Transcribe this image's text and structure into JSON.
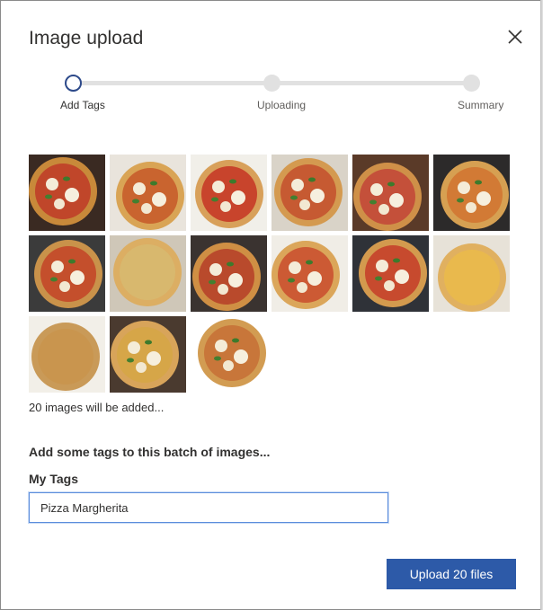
{
  "dialog": {
    "title": "Image upload"
  },
  "stepper": {
    "steps": [
      {
        "label": "Add Tags",
        "state": "active"
      },
      {
        "label": "Uploading",
        "state": "inactive"
      },
      {
        "label": "Summary",
        "state": "inactive"
      }
    ]
  },
  "thumbnails": [
    {
      "icon": "pizza-photo"
    },
    {
      "icon": "pizza-photo"
    },
    {
      "icon": "pizza-photo"
    },
    {
      "icon": "pizza-photo"
    },
    {
      "icon": "pizza-photo"
    },
    {
      "icon": "pizza-photo"
    },
    {
      "icon": "pizza-photo"
    },
    {
      "icon": "pizza-photo"
    },
    {
      "icon": "pizza-photo"
    },
    {
      "icon": "pizza-photo"
    },
    {
      "icon": "pizza-photo"
    },
    {
      "icon": "pizza-photo"
    },
    {
      "icon": "pizza-photo"
    },
    {
      "icon": "pizza-photo"
    },
    {
      "icon": "pizza-photo"
    }
  ],
  "summary": {
    "count_text": "20 images will be added..."
  },
  "tags_section": {
    "heading": "Add some tags to this batch of images...",
    "field_label": "My Tags",
    "input_value": "Pizza Margherita"
  },
  "footer": {
    "upload_label": "Upload 20 files"
  },
  "colors": {
    "accent": "#2d5aa8",
    "active_step_ring": "#2d4a8a",
    "track": "#e1e1e1",
    "input_border": "#5b8ddc"
  }
}
